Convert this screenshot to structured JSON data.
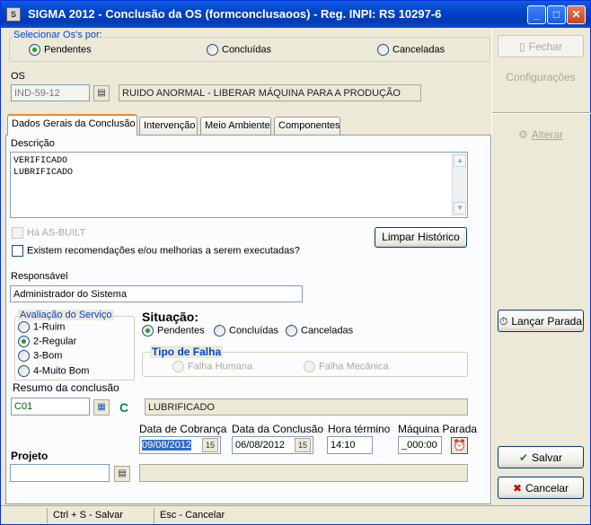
{
  "window": {
    "title": "SIGMA 2012 - Conclusão da OS  (formconclusaoos)  - Reg. INPI: RS 10297-6",
    "app_icon": "S",
    "minimize": "_",
    "maximize": "□",
    "close": "✕"
  },
  "filter": {
    "legend": "Selecionar Os's por:",
    "options": [
      "Pendentes",
      "Concluídas",
      "Canceladas"
    ],
    "selected": "Pendentes"
  },
  "os": {
    "label": "OS",
    "code": "IND-59-12",
    "description": "RUIDO ANORMAL - LIBERAR MÁQUINA PARA A PRODUÇÃO"
  },
  "tabs": [
    "Dados Gerais da Conclusão",
    "Intervenção",
    "Meio Ambiente",
    "Componentes"
  ],
  "active_tab": "Dados Gerais da Conclusão",
  "general": {
    "description_label": "Descrição",
    "description_lines": [
      "VERIFICADO",
      "LUBRIFICADO"
    ],
    "as_built_label": "Há AS-BUILT",
    "recommendations_label": "Existem recomendações e/ou melhorias a serem executadas?",
    "clear_history_button": "Limpar Histórico",
    "responsible_label": "Responsável",
    "responsible_value": "Administrador do Sistema",
    "evaluation": {
      "legend": "Avaliação do Serviço",
      "options": [
        "1-Ruim",
        "2-Regular",
        "3-Bom",
        "4-Muito Bom"
      ],
      "selected": "2-Regular"
    },
    "situation": {
      "label": "Situação:",
      "options": [
        "Pendentes",
        "Concluídas",
        "Canceladas"
      ],
      "selected": "Pendentes"
    },
    "failure_type": {
      "legend": "Tipo de Falha",
      "options": [
        "Falha Humana",
        "Falha Mecânica"
      ]
    },
    "summary_label": "Resumo da conclusão",
    "summary_code": "C01",
    "summary_c": "C",
    "summary_text": "LUBRIFICADO",
    "billing_date_label": "Data de Cobrança",
    "billing_date": "09/08/2012",
    "conclusion_date_label": "Data da Conclusão",
    "conclusion_date": "06/08/2012",
    "end_time_label": "Hora término",
    "end_time": "14:10",
    "machine_stopped_label": "Máquina Parada",
    "machine_stopped": "_000:00",
    "project_label": "Projeto",
    "project_value": "",
    "project_desc": "",
    "calendar_glyph": "15"
  },
  "side": {
    "close_button": "Fechar",
    "config_button": "Configurações",
    "edit_button": "Alterar",
    "stop_button": "Lançar Parada",
    "save_button": "Salvar",
    "cancel_button": "Cancelar"
  },
  "status": {
    "save_hint": "Ctrl + S - Salvar",
    "cancel_hint": "Esc - Cancelar"
  },
  "colors": {
    "title_bar": "#0443c8",
    "group_label": "#0046d5",
    "active_tab_accent": "#e68b2c",
    "radio_selected": "#21a121"
  }
}
